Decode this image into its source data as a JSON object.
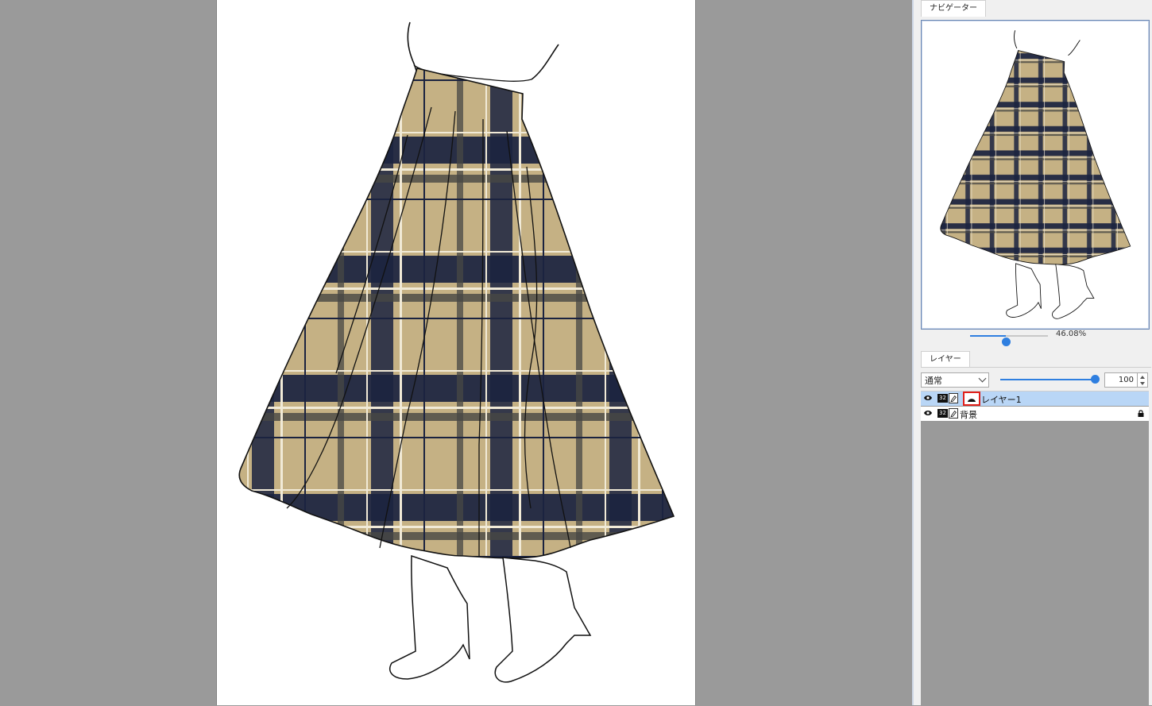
{
  "navigator": {
    "tab_label": "ナビゲーター",
    "zoom_text": "46.08%",
    "zoom_level": 0.46
  },
  "layers": {
    "tab_label": "レイヤー",
    "blend_mode": "通常",
    "opacity_value": "100",
    "items": [
      {
        "name": "レイヤー1",
        "depth": "32",
        "selected": true
      },
      {
        "name": "背景",
        "depth": "32",
        "selected": false,
        "locked": true
      }
    ]
  },
  "colors": {
    "workspace": "#9a9a9a",
    "plaid_base": "#c5b184",
    "plaid_navy": "#1b2340",
    "plaid_cream": "#f1ead7",
    "accent_blue": "#2f7fe0",
    "selected_row": "#b9d6f6",
    "highlight_red": "#e0201b"
  },
  "icons": [
    "eye-icon",
    "pencil-icon",
    "clipping-icon",
    "lock-icon",
    "chevron-down-icon"
  ]
}
